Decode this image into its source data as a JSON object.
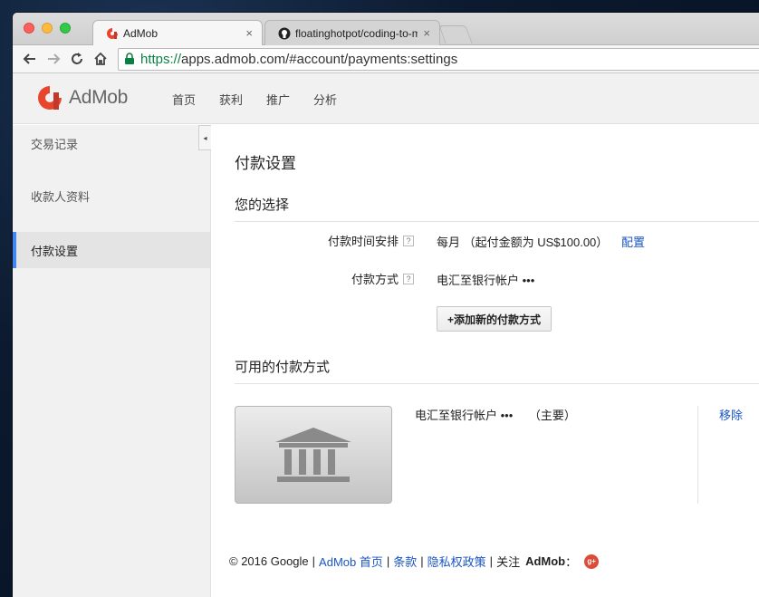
{
  "browser": {
    "tabs": [
      {
        "title": "AdMob",
        "active": true
      },
      {
        "title": "floatinghotpot/coding-to-m",
        "active": false
      }
    ],
    "url_scheme": "https://",
    "url_rest": "apps.admob.com/#account/payments:settings",
    "close_glyph": "×"
  },
  "header": {
    "logo_text": "AdMob",
    "nav": [
      "首页",
      "获利",
      "推广",
      "分析"
    ]
  },
  "sidebar": {
    "collapse_glyph": "◂",
    "items": [
      {
        "label": "交易记录",
        "active": false
      },
      {
        "label": "收款人资料",
        "active": false
      },
      {
        "label": "付款设置",
        "active": true
      }
    ]
  },
  "main": {
    "title": "付款设置",
    "your_choice": {
      "heading": "您的选择",
      "schedule_label": "付款时间安排",
      "schedule_value": "每月 （起付金额为 US$100.00）",
      "schedule_link": "配置",
      "method_label": "付款方式",
      "method_value": "电汇至银行帐户 •••",
      "add_button": "+添加新的付款方式",
      "help_glyph": "?"
    },
    "available": {
      "heading": "可用的付款方式",
      "method_title": "电汇至银行帐户 •••",
      "method_primary": "（主要）",
      "remove_link": "移除"
    }
  },
  "footer": {
    "copyright": "© 2016 Google",
    "links": [
      "AdMob 首页",
      "条款",
      "隐私权政策"
    ],
    "follow_prefix": "关注",
    "follow_brand": "AdMob",
    "follow_suffix": "："
  },
  "colors": {
    "accent": "#4285f4",
    "link": "#1a55c5",
    "logo_red": "#e8452c"
  }
}
